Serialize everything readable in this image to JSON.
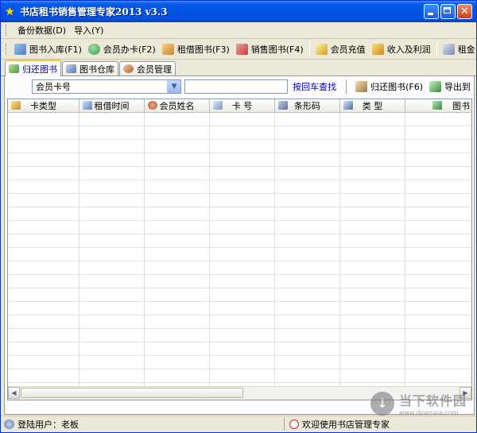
{
  "window": {
    "title": "书店租书销售管理专家2013 v3.3"
  },
  "menu": {
    "items": [
      "备份数据(D)",
      "导入(Y)"
    ]
  },
  "toolbar": {
    "buttons": [
      {
        "label": "图书入库(F1)",
        "icon": "book-in-icon",
        "color": "#4a7cc0"
      },
      {
        "label": "会员办卡(F2)",
        "icon": "member-card-icon",
        "color": "#3a9b4a"
      },
      {
        "label": "租借图书(F3)",
        "icon": "rent-book-icon",
        "color": "#c8862a"
      },
      {
        "label": "销售图书(F4)",
        "icon": "sell-book-icon",
        "color": "#c83a3a"
      },
      {
        "label": "会员充值",
        "icon": "recharge-icon",
        "color": "#d4a020"
      },
      {
        "label": "收入及利润",
        "icon": "income-icon",
        "color": "#d0b030"
      },
      {
        "label": "租金",
        "icon": "rent-fee-icon",
        "color": "#7a8ab0"
      }
    ]
  },
  "tabs": [
    {
      "label": "归还图书",
      "active": true
    },
    {
      "label": "图书仓库",
      "active": false
    },
    {
      "label": "会员管理",
      "active": false
    }
  ],
  "search": {
    "combo_value": "会员卡号",
    "text_value": "",
    "link_label": "按回车查找",
    "return_button": "归还图书(F6)",
    "export_button": "导出到"
  },
  "grid": {
    "columns": [
      "卡类型",
      "租借时间",
      "会员姓名",
      "卡 号",
      "条形码",
      "类 型",
      "图书"
    ]
  },
  "status": {
    "user": "登陆用户：老板",
    "message": "欢迎使用书店管理专家"
  },
  "watermark": {
    "name": "当下软件园",
    "url": "www.downxia.com"
  }
}
